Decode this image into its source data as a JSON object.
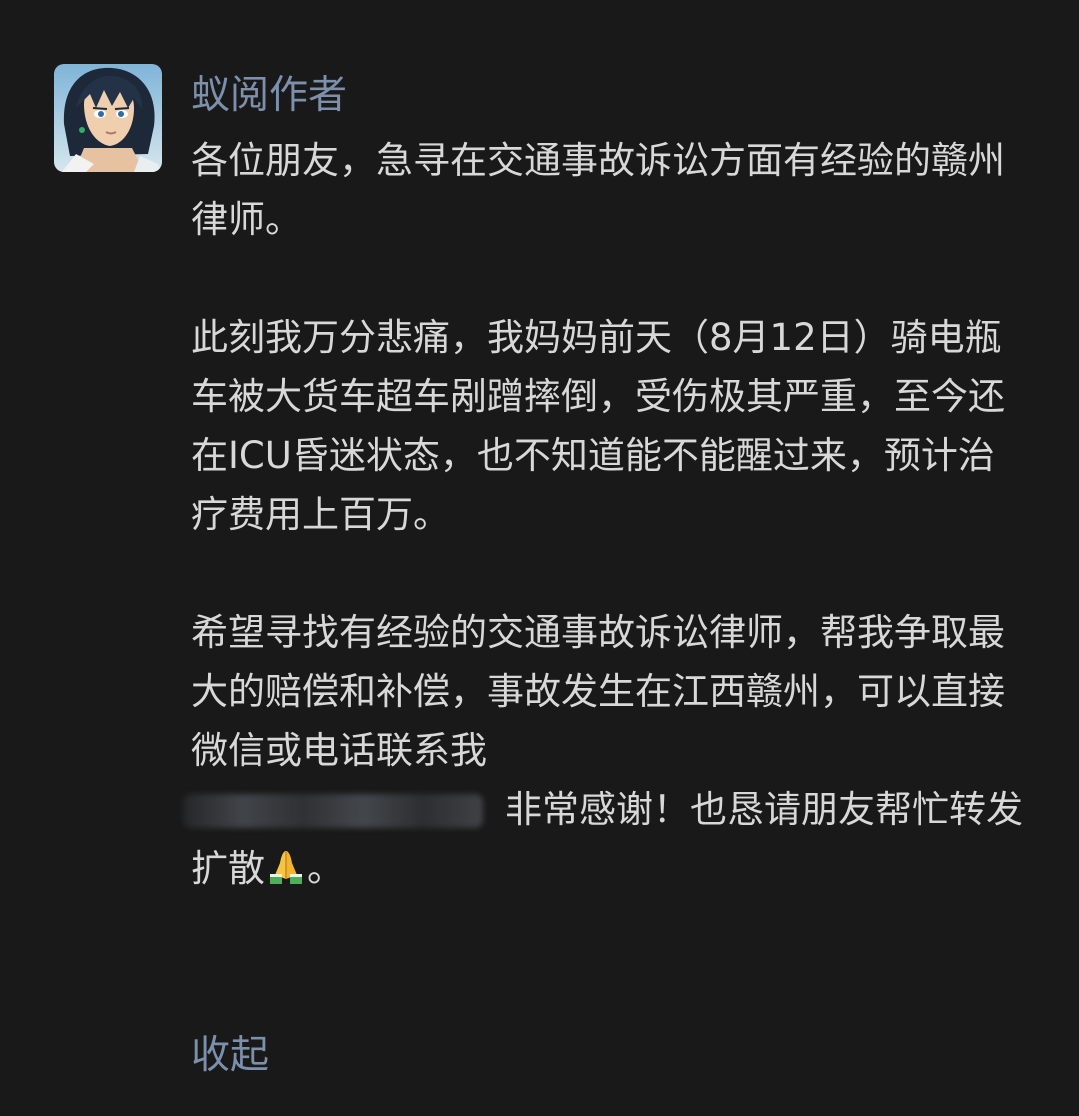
{
  "post": {
    "author": "蚁阅作者",
    "paragraphs": {
      "p1": "各位朋友，急寻在交通事故诉讼方面有经验的赣州律师。",
      "p2": "此刻我万分悲痛，我妈妈前天（8月12日）骑电瓶车被大货车超车剐蹭摔倒，受伤极其严重，至今还在ICU昏迷状态，也不知道能不能醒过来，预计治疗费用上百万。",
      "p3_before": "希望寻找有经验的交通事故诉讼律师，帮我争取最大的赔偿和补偿，事故发生在江西赣州，可以直接微信或电话联系我",
      "p3_after": "非常感谢！也恳请朋友帮忙转发扩散",
      "p3_end": "。"
    },
    "collapse_label": "收起"
  },
  "icons": {
    "avatar": "anime-character-avatar",
    "redacted_phone": "blurred-phone-number",
    "emoji": "folded-hands-emoji"
  },
  "colors": {
    "background": "#191919",
    "author_link": "#7c8fab",
    "body_text": "#d8d8d8"
  }
}
